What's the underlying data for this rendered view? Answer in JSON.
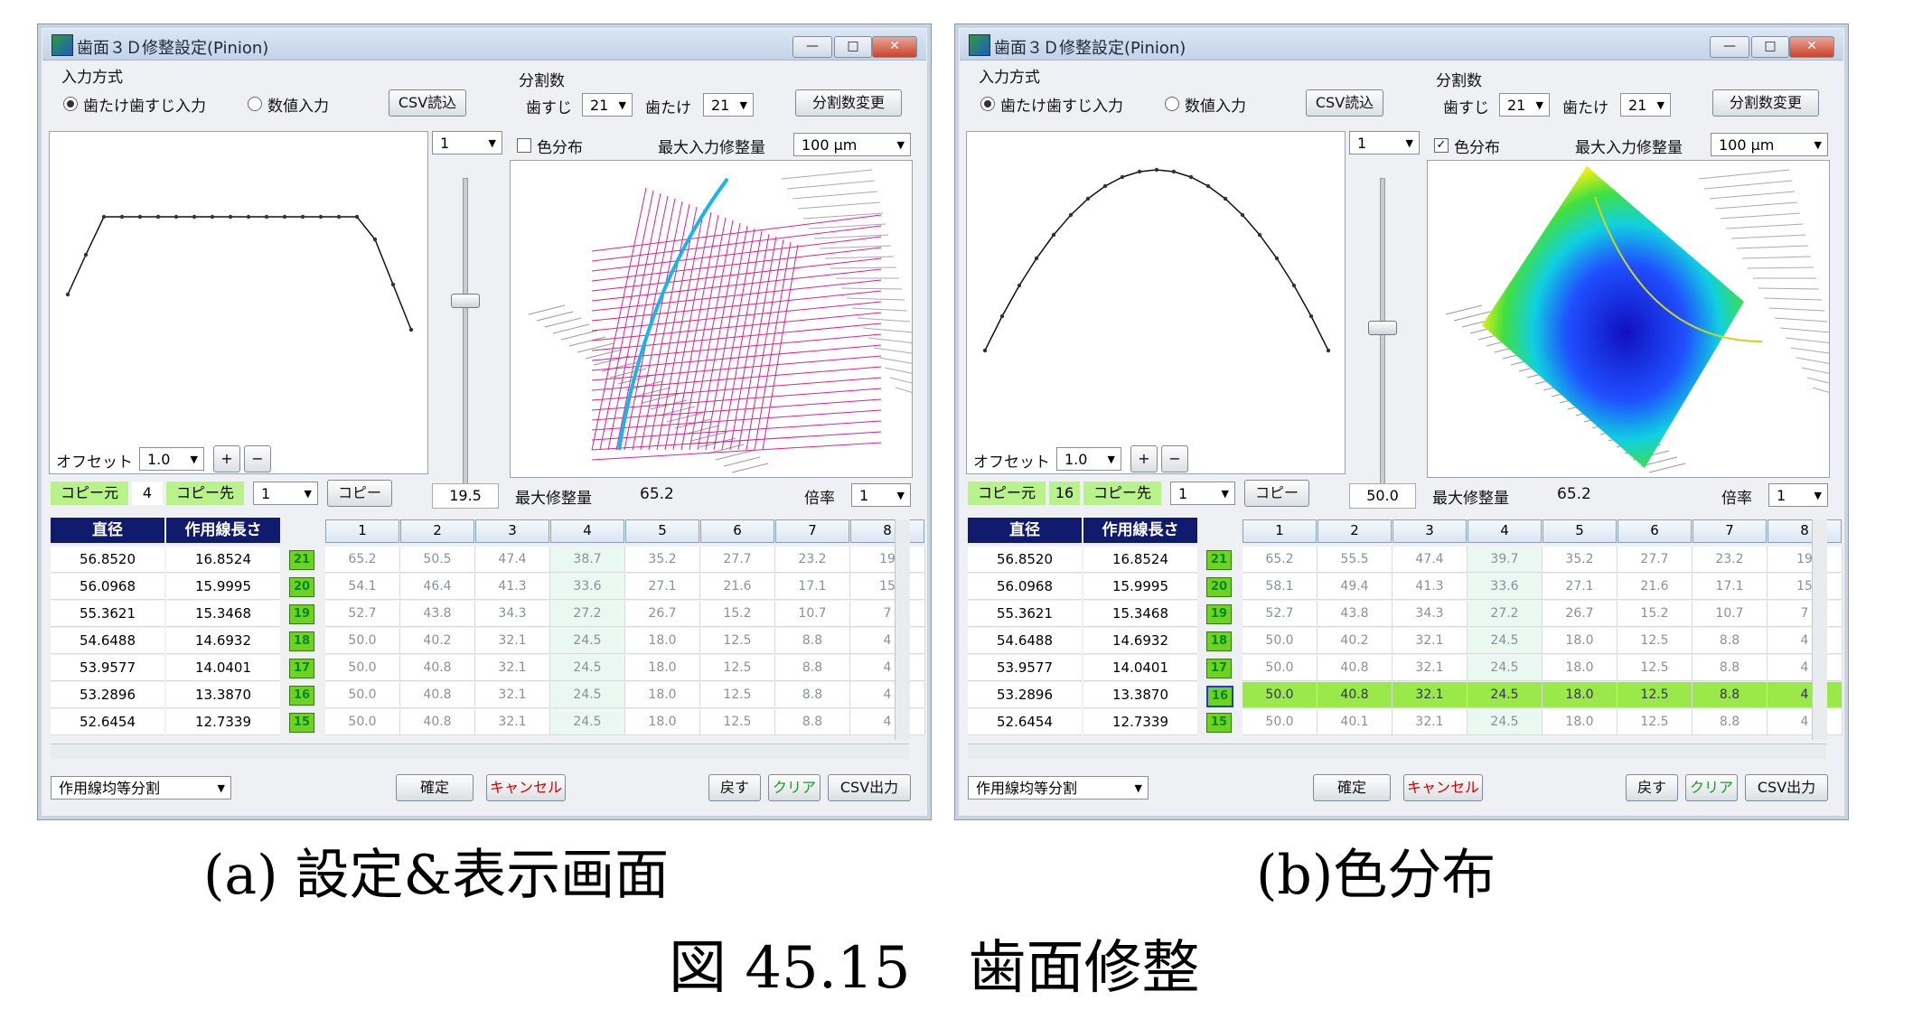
{
  "windows": [
    {
      "id": "a",
      "title": "歯面３Ｄ修整設定(Pinion)",
      "input_method_label": "入力方式",
      "radio_profile_label": "歯たけ歯すじ入力",
      "radio_numeric_label": "数値入力",
      "csv_read_label": "CSV読込",
      "division_label": "分割数",
      "lead_label": "歯すじ",
      "lead_value": "21",
      "profile_label": "歯たけ",
      "profile_value": "21",
      "division_change_label": "分割数変更",
      "curve_select": "1",
      "color_dist_label": "色分布",
      "color_dist_checked": false,
      "max_input_label": "最大入力修整量",
      "max_input_value": "100 μm",
      "offset_label": "オフセット",
      "offset_value": "1.0",
      "plus_label": "+",
      "minus_label": "−",
      "copy_from_label": "コピー元",
      "copy_from_value": "4",
      "copy_to_label": "コピー先",
      "copy_to_value": "1",
      "copy_label": "コピー",
      "slider_value": "19.5",
      "max_mod_label": "最大修整量",
      "max_mod_value": "65.2",
      "scale_label": "倍率",
      "scale_value": "1",
      "table_header_diameter": "直径",
      "table_header_length": "作用線長さ",
      "column_headers": [
        "1",
        "2",
        "3",
        "4",
        "5",
        "6",
        "7",
        "8"
      ],
      "rows": [
        {
          "diameter": "56.8520",
          "length": "16.8524",
          "num": "21",
          "cells": [
            "65.2",
            "50.5",
            "47.4",
            "38.7",
            "35.2",
            "27.7",
            "23.2",
            "19"
          ]
        },
        {
          "diameter": "56.0968",
          "length": "15.9995",
          "num": "20",
          "cells": [
            "54.1",
            "46.4",
            "41.3",
            "33.6",
            "27.1",
            "21.6",
            "17.1",
            "15"
          ]
        },
        {
          "diameter": "55.3621",
          "length": "15.3468",
          "num": "19",
          "cells": [
            "52.7",
            "43.8",
            "34.3",
            "27.2",
            "26.7",
            "15.2",
            "10.7",
            "7"
          ]
        },
        {
          "diameter": "54.6488",
          "length": "14.6932",
          "num": "18",
          "cells": [
            "50.0",
            "40.2",
            "32.1",
            "24.5",
            "18.0",
            "12.5",
            "8.8",
            "4"
          ]
        },
        {
          "diameter": "53.9577",
          "length": "14.0401",
          "num": "17",
          "cells": [
            "50.0",
            "40.8",
            "32.1",
            "24.5",
            "18.0",
            "12.5",
            "8.8",
            "4"
          ]
        },
        {
          "diameter": "53.2896",
          "length": "13.3870",
          "num": "16",
          "cells": [
            "50.0",
            "40.8",
            "32.1",
            "24.5",
            "18.0",
            "12.5",
            "8.8",
            "4"
          ]
        },
        {
          "diameter": "52.6454",
          "length": "12.7339",
          "num": "15",
          "cells": [
            "50.0",
            "40.8",
            "32.1",
            "24.5",
            "18.0",
            "12.5",
            "8.8",
            "4"
          ]
        }
      ],
      "division_mode": "作用線均等分割",
      "confirm_label": "確定",
      "cancel_label": "キャンセル",
      "back_label": "戻す",
      "clear_label": "クリア",
      "csv_out_label": "CSV出力"
    },
    {
      "id": "b",
      "title": "歯面３Ｄ修整設定(Pinion)",
      "input_method_label": "入力方式",
      "radio_profile_label": "歯たけ歯すじ入力",
      "radio_numeric_label": "数値入力",
      "csv_read_label": "CSV読込",
      "division_label": "分割数",
      "lead_label": "歯すじ",
      "lead_value": "21",
      "profile_label": "歯たけ",
      "profile_value": "21",
      "division_change_label": "分割数変更",
      "curve_select": "1",
      "color_dist_label": "色分布",
      "color_dist_checked": true,
      "max_input_label": "最大入力修整量",
      "max_input_value": "100 μm",
      "offset_label": "オフセット",
      "offset_value": "1.0",
      "plus_label": "+",
      "minus_label": "−",
      "copy_from_label": "コピー元",
      "copy_from_value": "16",
      "copy_to_label": "コピー先",
      "copy_to_value": "1",
      "copy_label": "コピー",
      "slider_value": "50.0",
      "max_mod_label": "最大修整量",
      "max_mod_value": "65.2",
      "scale_label": "倍率",
      "scale_value": "1",
      "table_header_diameter": "直径",
      "table_header_length": "作用線長さ",
      "column_headers": [
        "1",
        "2",
        "3",
        "4",
        "5",
        "6",
        "7",
        "8"
      ],
      "rows": [
        {
          "diameter": "56.8520",
          "length": "16.8524",
          "num": "21",
          "cells": [
            "65.2",
            "55.5",
            "47.4",
            "39.7",
            "35.2",
            "27.7",
            "23.2",
            "19"
          ]
        },
        {
          "diameter": "56.0968",
          "length": "15.9995",
          "num": "20",
          "cells": [
            "58.1",
            "49.4",
            "41.3",
            "33.6",
            "27.1",
            "21.6",
            "17.1",
            "15"
          ]
        },
        {
          "diameter": "55.3621",
          "length": "15.3468",
          "num": "19",
          "cells": [
            "52.7",
            "43.8",
            "34.3",
            "27.2",
            "26.7",
            "15.2",
            "10.7",
            "7"
          ]
        },
        {
          "diameter": "54.6488",
          "length": "14.6932",
          "num": "18",
          "cells": [
            "50.0",
            "40.2",
            "32.1",
            "24.5",
            "18.0",
            "12.5",
            "8.8",
            "4"
          ]
        },
        {
          "diameter": "53.9577",
          "length": "14.0401",
          "num": "17",
          "cells": [
            "50.0",
            "40.8",
            "32.1",
            "24.5",
            "18.0",
            "12.5",
            "8.8",
            "4"
          ]
        },
        {
          "diameter": "53.2896",
          "length": "13.3870",
          "num": "16",
          "cells": [
            "50.0",
            "40.8",
            "32.1",
            "24.5",
            "18.0",
            "12.5",
            "8.8",
            "4"
          ],
          "highlight": true
        },
        {
          "diameter": "52.6454",
          "length": "12.7339",
          "num": "15",
          "cells": [
            "50.0",
            "40.1",
            "32.1",
            "24.5",
            "18.0",
            "12.5",
            "8.8",
            "4"
          ]
        }
      ],
      "division_mode": "作用線均等分割",
      "confirm_label": "確定",
      "cancel_label": "キャンセル",
      "back_label": "戻す",
      "clear_label": "クリア",
      "csv_out_label": "CSV出力"
    }
  ],
  "captions": {
    "a": "(a)  設定&表示画面",
    "b": "(b)色分布",
    "figure": "図 45.15　歯面修整"
  }
}
